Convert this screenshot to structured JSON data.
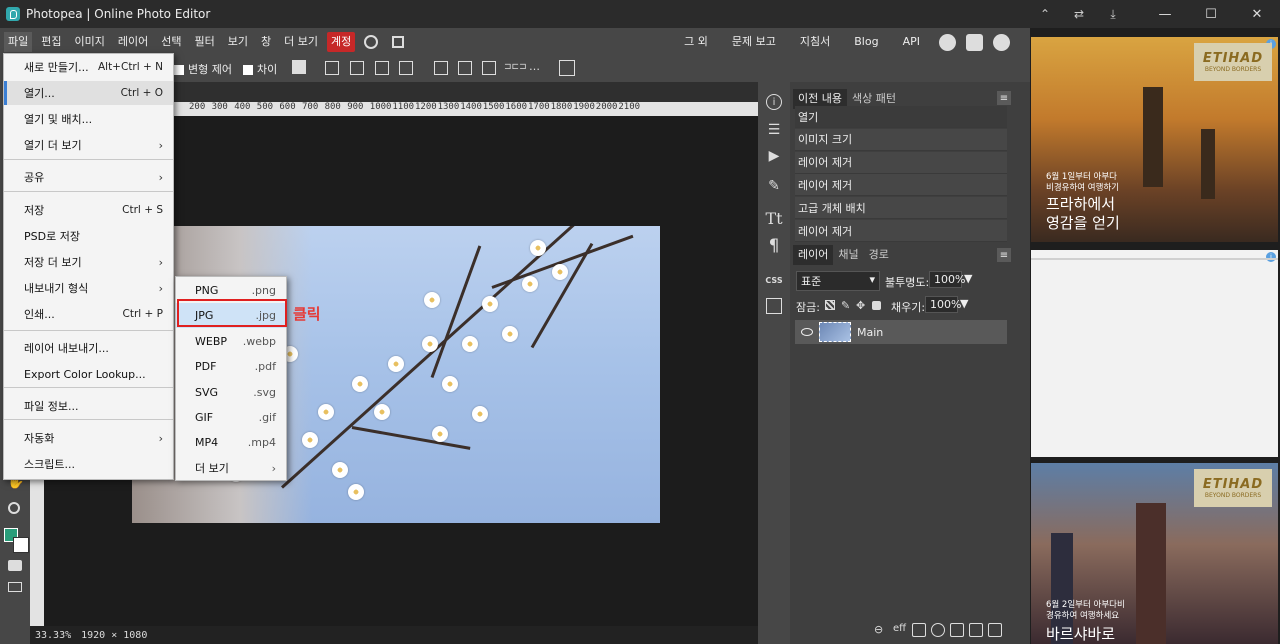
{
  "window": {
    "title": "Photopea | Online Photo Editor",
    "controls": [
      "—",
      "☐",
      "✕"
    ]
  },
  "menubar": {
    "items": [
      "파일",
      "편집",
      "이미지",
      "레이어",
      "선택",
      "필터",
      "보기",
      "창",
      "더 보기",
      "계정"
    ],
    "right_items": [
      "그 외",
      "문제 보고",
      "지침서",
      "Blog",
      "API"
    ]
  },
  "optionsbar": {
    "transform_label": "변형 제어",
    "diff_label": "차이"
  },
  "file_menu": {
    "items": [
      {
        "label": "새로 만들기...",
        "shortcut": "Alt+Ctrl + N"
      },
      {
        "label": "열기...",
        "shortcut": "Ctrl + O"
      },
      {
        "label": "열기 및 배치..."
      },
      {
        "label": "열기 더 보기",
        "arrow": "›"
      },
      {
        "label": "공유",
        "arrow": "›"
      },
      {
        "label": "저장",
        "shortcut": "Ctrl + S"
      },
      {
        "label": "PSD로 저장"
      },
      {
        "label": "저장 더 보기",
        "arrow": "›"
      },
      {
        "label": "내보내기 형식",
        "arrow": "›"
      },
      {
        "label": "인쇄...",
        "shortcut": "Ctrl + P"
      },
      {
        "label": "레이어 내보내기..."
      },
      {
        "label": "Export Color Lookup..."
      },
      {
        "label": "파일 정보..."
      },
      {
        "label": "자동화",
        "arrow": "›"
      },
      {
        "label": "스크립트..."
      }
    ]
  },
  "export_submenu": {
    "items": [
      {
        "label": "PNG",
        "ext": ".png"
      },
      {
        "label": "JPG",
        "ext": ".jpg"
      },
      {
        "label": "WEBP",
        "ext": ".webp"
      },
      {
        "label": "PDF",
        "ext": ".pdf"
      },
      {
        "label": "SVG",
        "ext": ".svg"
      },
      {
        "label": "GIF",
        "ext": ".gif"
      },
      {
        "label": "MP4",
        "ext": ".mp4"
      },
      {
        "label": "더 보기",
        "ext": "›"
      }
    ],
    "annotation": "클릭"
  },
  "ruler": {
    "ticks": [
      "200",
      "300",
      "400",
      "500",
      "600",
      "700",
      "800",
      "900",
      "1000",
      "1100",
      "1200",
      "1300",
      "1400",
      "1500",
      "1600",
      "1700",
      "1800",
      "1900",
      "2000",
      "2100"
    ]
  },
  "status": {
    "zoom": "33.33%",
    "size": "1920 × 1080"
  },
  "history_panel": {
    "tabs": [
      "이전 내용",
      "색상 패턴"
    ],
    "items": [
      "열기",
      "이미지 크기",
      "레이어 제거",
      "레이어 제거",
      "고급 개체 배치",
      "레이어 제거"
    ]
  },
  "layers_panel": {
    "tabs": [
      "레이어",
      "채널",
      "경로"
    ],
    "blend_mode": "표준",
    "opacity_label": "불투명도:",
    "opacity_value": "100%",
    "lock_label": "잠금:",
    "fill_label": "채우기:",
    "fill_value": "100%",
    "layer_name": "Main"
  },
  "right_icons": {
    "css_label": "CSS"
  },
  "ads": {
    "brand": "ETIHAD",
    "brand_sub": "BEYOND BORDERS",
    "ad1_small": [
      "6월 1일부터 아부다",
      "비경유하여 여행하기"
    ],
    "ad1_big": [
      "프라하에서",
      "영감을 얻기"
    ],
    "ad3_small": [
      "6월 2일부터 아부다비",
      "경유하여 여행하세요"
    ],
    "ad3_big": "바르샤바로"
  },
  "colors": {
    "accent_red": "#c62828",
    "foreground_swatch": "#2a9d7a",
    "background_swatch": "#ffffff"
  }
}
